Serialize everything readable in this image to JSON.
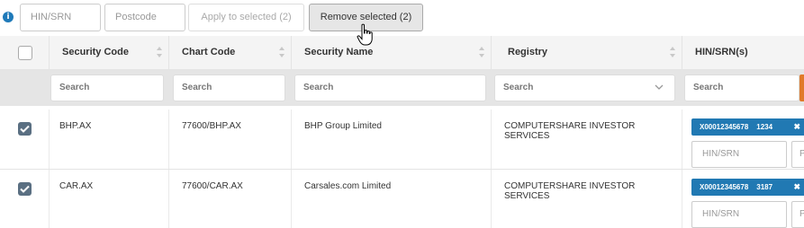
{
  "toolbar": {
    "info_icon": "info-icon",
    "hin_placeholder": "HIN/SRN",
    "postcode_placeholder": "Postcode",
    "apply_label": "Apply to selected (2)",
    "remove_label": "Remove selected (2)"
  },
  "table": {
    "columns": [
      "Security Code",
      "Chart Code",
      "Security Name",
      "Registry",
      "HIN/SRN(s)"
    ],
    "filters": [
      "Search",
      "Search",
      "Search",
      "Search",
      "Search"
    ],
    "rows": [
      {
        "checked": true,
        "security_code": "BHP.AX",
        "chart_code": "77600/BHP.AX",
        "security_name": "BHP Group Limited",
        "registry": "COMPUTERSHARE INVESTOR SERVICES",
        "hin": "X00012345678",
        "postcode": "1234",
        "hin_placeholder": "HIN/SRN",
        "postcode_placeholder": "P"
      },
      {
        "checked": true,
        "security_code": "CAR.AX",
        "chart_code": "77600/CAR.AX",
        "security_name": "Carsales.com Limited",
        "registry": "COMPUTERSHARE INVESTOR SERVICES",
        "hin": "X00012345678",
        "postcode": "3187",
        "hin_placeholder": "HIN/SRN",
        "postcode_placeholder": "P"
      }
    ]
  },
  "colors": {
    "accent": "#2179b3",
    "checkbox": "#5a6f82",
    "header_bg": "#f4f4f4",
    "filter_bg": "#e5e5e5"
  }
}
